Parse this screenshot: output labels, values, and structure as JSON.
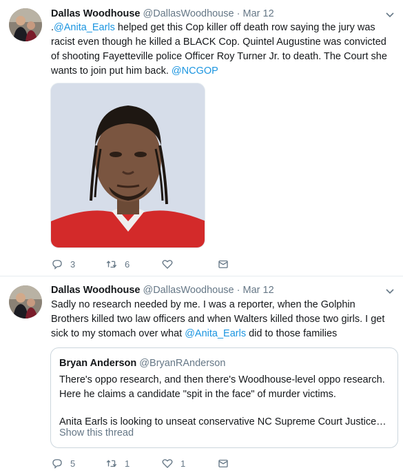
{
  "tweets": [
    {
      "author_name": "Dallas Woodhouse",
      "handle": "@DallasWoodhouse",
      "separator": "·",
      "date": "Mar 12",
      "text_parts": [
        {
          "text": ".",
          "link": false
        },
        {
          "text": "@Anita_Earls",
          "link": true
        },
        {
          "text": " helped get this Cop killer off death row saying the jury was racist even though he killed a BLACK Cop. Quintel Augustine was convicted of shooting Fayetteville police Officer Roy Turner Jr. to death. The Court she wants to join put him back. ",
          "link": false
        },
        {
          "text": "@NCGOP",
          "link": true
        }
      ],
      "actions": {
        "replies": "3",
        "retweets": "6",
        "likes": ""
      }
    },
    {
      "author_name": "Dallas Woodhouse",
      "handle": "@DallasWoodhouse",
      "separator": "·",
      "date": "Mar 12",
      "text_parts": [
        {
          "text": "Sadly no research needed by me. I was a reporter, when the Golphin Brothers killed two law officers and when Walters killed those two girls. I get sick to my stomach over what ",
          "link": false
        },
        {
          "text": "@Anita_Earls",
          "link": true
        },
        {
          "text": " did to those families",
          "link": false
        }
      ],
      "quoted": {
        "author_name": "Bryan Anderson",
        "handle": "@BryanRAnderson",
        "text": "There's oppo research, and then there's Woodhouse-level oppo research. Here he claims a candidate \"spit in the face\" of murder victims.",
        "text2": "Anita Earls is looking to unseat conservative NC Supreme Court Justice…",
        "show_thread": "Show this thread"
      },
      "actions": {
        "replies": "5",
        "retweets": "1",
        "likes": "1"
      }
    }
  ],
  "icons": {
    "reply": "reply-icon",
    "retweet": "retweet-icon",
    "like": "heart-icon",
    "dm": "envelope-icon",
    "caret": "chevron-down-icon"
  },
  "colors": {
    "link": "#1b95e0",
    "secondary_text": "#657786",
    "divider": "#e6ecf0"
  }
}
